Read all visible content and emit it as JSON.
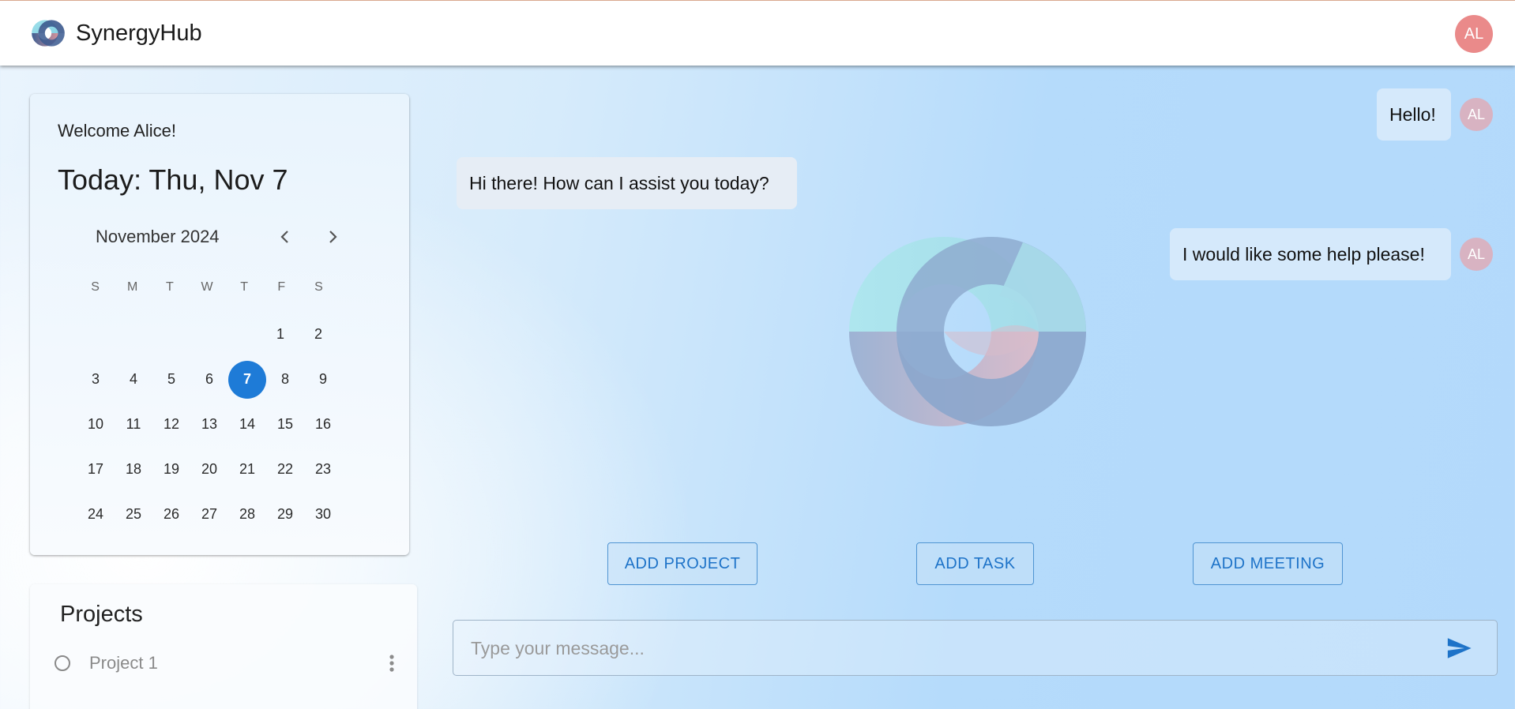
{
  "header": {
    "app_name": "SynergyHub",
    "logo_icon": "synergyhub-logo-icon",
    "avatar_initials": "AL"
  },
  "calendar": {
    "welcome": "Welcome Alice!",
    "today_label": "Today: Thu, Nov 7",
    "month_label": "November 2024",
    "prev_icon": "chevron-left-icon",
    "next_icon": "chevron-right-icon",
    "weekdays": [
      "S",
      "M",
      "T",
      "W",
      "T",
      "F",
      "S"
    ],
    "weeks": [
      [
        "",
        "",
        "",
        "",
        "",
        "1",
        "2"
      ],
      [
        "3",
        "4",
        "5",
        "6",
        "7",
        "8",
        "9"
      ],
      [
        "10",
        "11",
        "12",
        "13",
        "14",
        "15",
        "16"
      ],
      [
        "17",
        "18",
        "19",
        "20",
        "21",
        "22",
        "23"
      ],
      [
        "24",
        "25",
        "26",
        "27",
        "28",
        "29",
        "30"
      ]
    ],
    "selected_day": "7",
    "selected_color": "#1e7bd7"
  },
  "projects": {
    "title": "Projects",
    "items": [
      {
        "name": "Project 1",
        "checked": false,
        "menu_icon": "more-vertical-icon"
      }
    ]
  },
  "chat": {
    "messages": [
      {
        "sender": "user",
        "text": "Hello!",
        "avatar": "AL"
      },
      {
        "sender": "assistant",
        "text": "Hi there! How can I assist you today?"
      },
      {
        "sender": "user",
        "text": "I would like some help please!",
        "avatar": "AL"
      }
    ],
    "watermark_icon": "synergyhub-logo-icon"
  },
  "actions": {
    "add_project": "ADD PROJECT",
    "add_task": "ADD TASK",
    "add_meeting": "ADD MEETING"
  },
  "composer": {
    "placeholder": "Type your message...",
    "value": "",
    "send_icon": "send-icon"
  },
  "colors": {
    "accent": "#1e73c8",
    "header_avatar": "#ea8a8a",
    "message_avatar": "#d8b3c2"
  }
}
